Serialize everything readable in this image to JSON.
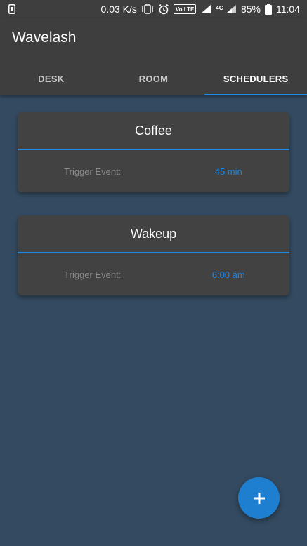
{
  "status_bar": {
    "speed": "0.03 K/s",
    "volte": "Vo LTE",
    "network": "4G",
    "battery": "85%",
    "time": "11:04"
  },
  "app": {
    "title": "Wavelash"
  },
  "tabs": [
    {
      "label": "DESK",
      "active": false
    },
    {
      "label": "ROOM",
      "active": false
    },
    {
      "label": "SCHEDULERS",
      "active": true
    }
  ],
  "schedulers": [
    {
      "name": "Coffee",
      "trigger_label": "Trigger Event:",
      "trigger_value": "45 min"
    },
    {
      "name": "Wakeup",
      "trigger_label": "Trigger Event:",
      "trigger_value": "6:00 am"
    }
  ],
  "fab": {
    "icon": "plus-icon"
  },
  "colors": {
    "accent": "#1e88e5",
    "background": "#344a60",
    "bar": "#3e3e3e",
    "card": "#424242"
  }
}
